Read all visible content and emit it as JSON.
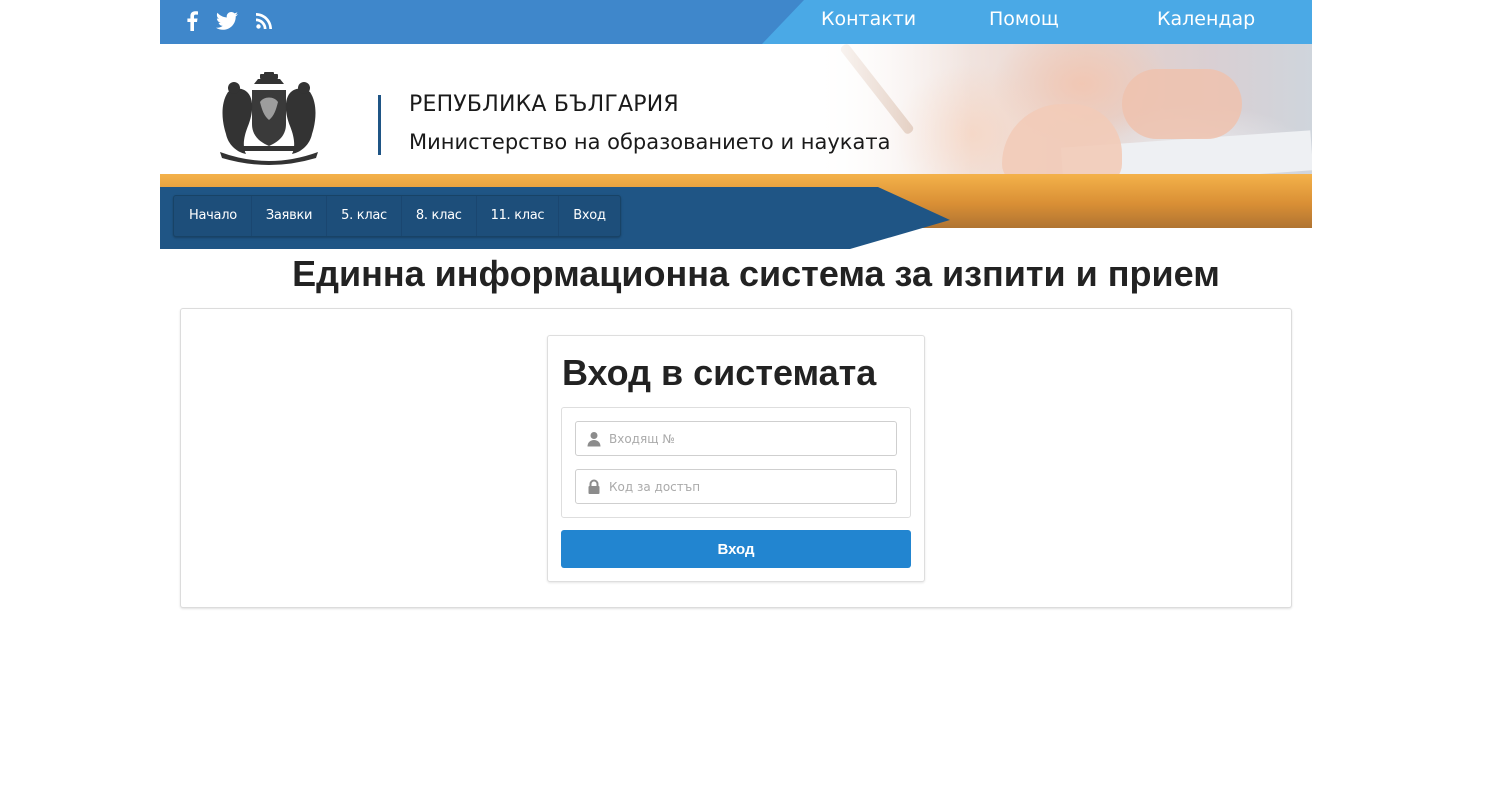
{
  "topbar": {
    "social": [
      {
        "icon": "facebook-icon"
      },
      {
        "icon": "twitter-icon"
      },
      {
        "icon": "rss-icon"
      }
    ],
    "links": [
      {
        "label": "Контакти"
      },
      {
        "label": "Помощ"
      },
      {
        "label": "Календар"
      }
    ]
  },
  "header": {
    "country": "РЕПУБЛИКА БЪЛГАРИЯ",
    "ministry": "Министерство на образованието и науката"
  },
  "nav": {
    "items": [
      {
        "label": "Начало"
      },
      {
        "label": "Заявки"
      },
      {
        "label": "5. клас"
      },
      {
        "label": "8. клас"
      },
      {
        "label": "11. клас"
      },
      {
        "label": "Вход"
      }
    ]
  },
  "page": {
    "title": "Единна информационна система за изпити и прием"
  },
  "login": {
    "heading": "Вход в системата",
    "number_placeholder": "Входящ №",
    "code_placeholder": "Код за достъп",
    "submit_label": "Вход"
  },
  "colors": {
    "topbar": "#3f87cb",
    "topbar_light": "#4aa9e6",
    "nav": "#1f5585",
    "accent_orange": "#f4b24a",
    "button": "#2285d0"
  }
}
